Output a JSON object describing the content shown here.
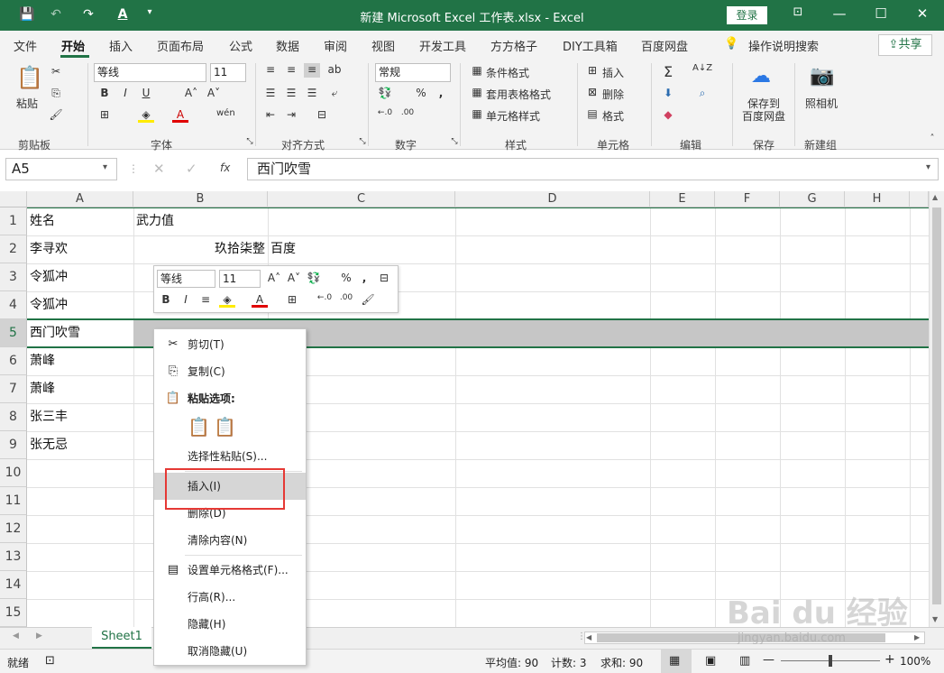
{
  "title": "新建 Microsoft Excel 工作表.xlsx - Excel",
  "login": "登录",
  "share": "共享",
  "tabs": [
    "文件",
    "开始",
    "插入",
    "页面布局",
    "公式",
    "数据",
    "审阅",
    "视图",
    "开发工具",
    "方方格子",
    "DIY工具箱",
    "百度网盘",
    "操作说明搜索"
  ],
  "ribbon": {
    "paste": "粘贴",
    "clipboard": "剪贴板",
    "font_name": "等线",
    "font_size": "11",
    "font": "字体",
    "align": "对齐方式",
    "number_format": "常规",
    "number": "数字",
    "cond_format": "条件格式",
    "table_format": "套用表格格式",
    "cell_style": "单元格样式",
    "styles": "样式",
    "insert": "插入",
    "delete": "删除",
    "format": "格式",
    "cells": "单元格",
    "editing": "编辑",
    "save_to": "保存到",
    "baidu_disk": "百度网盘",
    "save": "保存",
    "camera": "照相机",
    "newgroup": "新建组"
  },
  "namebox": "A5",
  "formula_content": "西门吹雪",
  "fx": "fx",
  "columns": [
    "A",
    "B",
    "C",
    "D",
    "E",
    "F",
    "G",
    "H"
  ],
  "rows": [
    "1",
    "2",
    "3",
    "4",
    "5",
    "6",
    "7",
    "8",
    "9",
    "10",
    "11",
    "12",
    "13",
    "14",
    "15"
  ],
  "cells": {
    "a1": "姓名",
    "b1": "武力值",
    "a2": "李寻欢",
    "b2": "玖拾柒整",
    "c2": "百度",
    "a3": "令狐冲",
    "a4": "令狐冲",
    "a5": "西门吹雪",
    "a6": "萧峰",
    "a7": "萧峰",
    "a8": "张三丰",
    "a9": "张无忌"
  },
  "minitoolbar": {
    "font_name": "等线",
    "font_size": "11"
  },
  "context_menu": {
    "cut": "剪切(T)",
    "copy": "复制(C)",
    "paste_options": "粘贴选项:",
    "paste_special": "选择性粘贴(S)...",
    "insert": "插入(I)",
    "delete": "删除(D)",
    "clear": "清除内容(N)",
    "format_cells": "设置单元格格式(F)...",
    "row_height": "行高(R)...",
    "hide": "隐藏(H)",
    "unhide": "取消隐藏(U)"
  },
  "sheet_tab": "Sheet1",
  "status": {
    "ready": "就绪",
    "average": "平均值: 90",
    "count": "计数: 3",
    "sum": "求和: 90",
    "zoom": "100%"
  },
  "watermark": {
    "logo": "Bai du 经验",
    "url": "jingyan.baidu.com"
  },
  "colors": {
    "excel_green": "#217346",
    "highlight_red": "#e53935"
  }
}
